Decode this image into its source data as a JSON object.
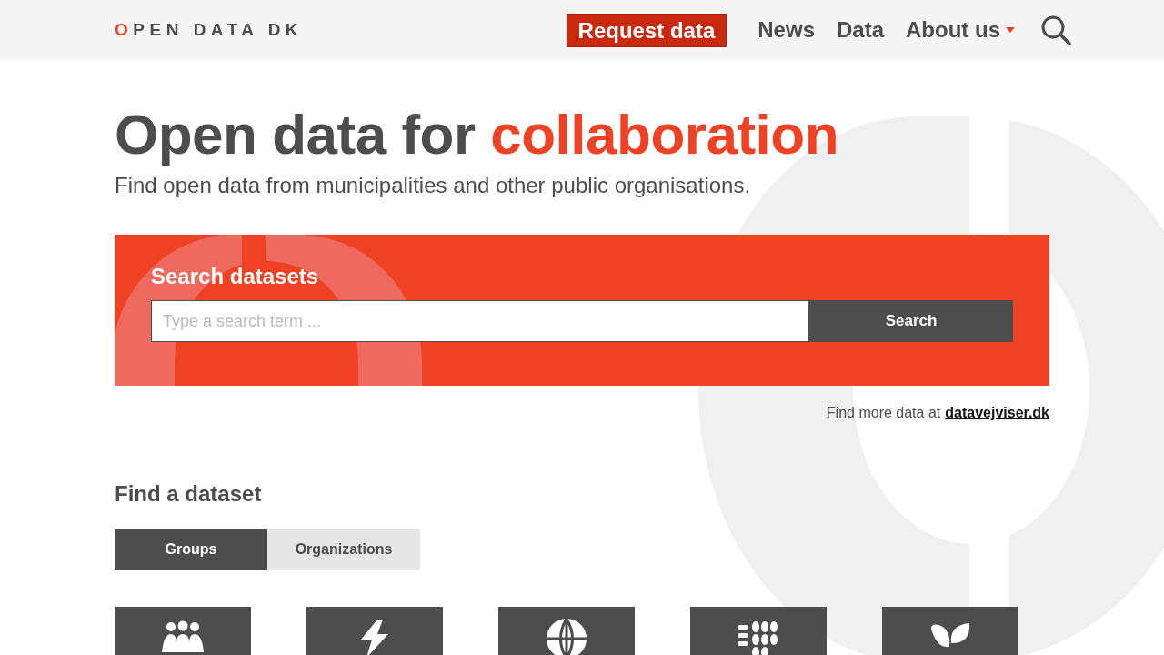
{
  "header": {
    "logo": "OPEN DATA DK",
    "request_button": "Request data",
    "nav": [
      {
        "label": "News",
        "dropdown": false
      },
      {
        "label": "Data",
        "dropdown": false
      },
      {
        "label": "About us",
        "dropdown": true
      }
    ]
  },
  "hero": {
    "title": "Open data for",
    "title_highlight": "collaboration",
    "subtitle": "Find open data from municipalities and other public organisations."
  },
  "search": {
    "heading": "Search datasets",
    "placeholder": "Type a search term ...",
    "button": "Search"
  },
  "more_data": {
    "text": "Find more data at",
    "link": "datavejviser.dk"
  },
  "finder": {
    "heading": "Find a dataset",
    "tabs": [
      {
        "label": "Groups",
        "selected": true
      },
      {
        "label": "Organizations",
        "selected": false
      }
    ],
    "tiles": [
      {
        "kind": "people"
      },
      {
        "kind": "lightning"
      },
      {
        "kind": "globe"
      },
      {
        "kind": "grain"
      },
      {
        "kind": "leaf"
      }
    ]
  }
}
